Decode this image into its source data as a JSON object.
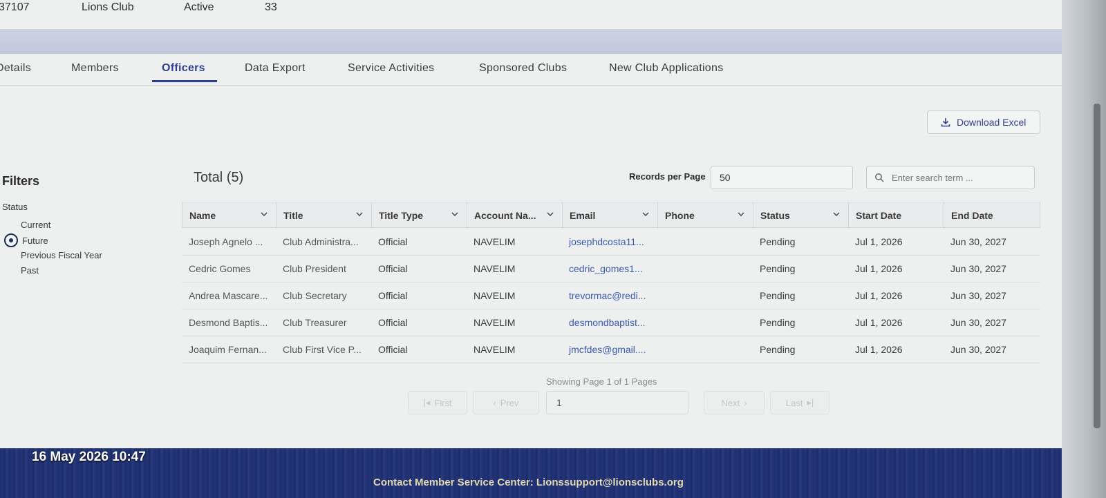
{
  "summary": {
    "club_number": "37107",
    "club_type": "Lions Club",
    "status": "Active",
    "count": "33"
  },
  "tabs": [
    {
      "label": "Details"
    },
    {
      "label": "Members"
    },
    {
      "label": "Officers"
    },
    {
      "label": "Data Export"
    },
    {
      "label": "Service Activities"
    },
    {
      "label": "Sponsored Clubs"
    },
    {
      "label": "New Club Applications"
    }
  ],
  "active_tab": "Officers",
  "download_label": "Download Excel",
  "filters": {
    "title": "Filters",
    "status_label": "Status",
    "options": [
      "Current",
      "Future",
      "Previous Fiscal Year",
      "Past"
    ],
    "selected": "Future"
  },
  "total_label": "Total (5)",
  "records_per_page": {
    "label": "Records per Page",
    "value": "50"
  },
  "search": {
    "placeholder": "Enter search term ..."
  },
  "columns": [
    "Name",
    "Title",
    "Title Type",
    "Account Na...",
    "Email",
    "Phone",
    "Status",
    "Start Date",
    "End Date"
  ],
  "rows": [
    {
      "name": "Joseph Agnelo ...",
      "title": "Club Administra...",
      "title_type": "Official",
      "account": "NAVELIM",
      "email": "josephdcosta11...",
      "phone": "",
      "status": "Pending",
      "start": "Jul 1, 2026",
      "end": "Jun 30, 2027"
    },
    {
      "name": "Cedric Gomes",
      "title": "Club President",
      "title_type": "Official",
      "account": "NAVELIM",
      "email": "cedric_gomes1...",
      "phone": "",
      "status": "Pending",
      "start": "Jul 1, 2026",
      "end": "Jun 30, 2027"
    },
    {
      "name": "Andrea Mascare...",
      "title": "Club Secretary",
      "title_type": "Official",
      "account": "NAVELIM",
      "email": "trevormac@redi...",
      "phone": "",
      "status": "Pending",
      "start": "Jul 1, 2026",
      "end": "Jun 30, 2027"
    },
    {
      "name": "Desmond Baptis...",
      "title": "Club Treasurer",
      "title_type": "Official",
      "account": "NAVELIM",
      "email": "desmondbaptist...",
      "phone": "",
      "status": "Pending",
      "start": "Jul 1, 2026",
      "end": "Jun 30, 2027"
    },
    {
      "name": "Joaquim Fernan...",
      "title": "Club First Vice P...",
      "title_type": "Official",
      "account": "NAVELIM",
      "email": "jmcfdes@gmail....",
      "phone": "",
      "status": "Pending",
      "start": "Jul 1, 2026",
      "end": "Jun 30, 2027"
    }
  ],
  "pagination": {
    "info": "Showing Page 1 of 1 Pages",
    "first": "First",
    "prev": "Prev",
    "page": "1",
    "next": "Next",
    "last": "Last"
  },
  "footer": {
    "contact": "Contact Member Service Center: Lionssupport@lionsclubs.org"
  },
  "timestamp": "16 May 2026 10:47"
}
